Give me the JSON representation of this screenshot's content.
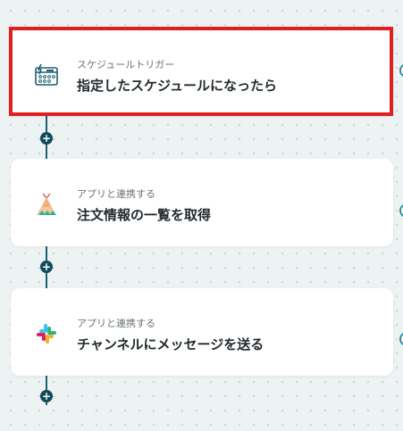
{
  "flow": {
    "steps": [
      {
        "subtitle": "スケジュールトリガー",
        "title": "指定したスケジュールになったら",
        "icon": "schedule-trigger-icon",
        "selected": true
      },
      {
        "subtitle": "アプリと連携する",
        "title": "注文情報の一覧を取得",
        "icon": "teepee-app-icon",
        "selected": false
      },
      {
        "subtitle": "アプリと連携する",
        "title": "チャンネルにメッセージを送る",
        "icon": "slack-icon",
        "selected": false
      }
    ],
    "add_button_label": "+"
  },
  "colors": {
    "selection_border": "#e02020",
    "connector": "#1f5f6e",
    "add_button": "#0f4b5b",
    "schedule_icon": "#1f5f6e",
    "background": "#edf2f3"
  }
}
